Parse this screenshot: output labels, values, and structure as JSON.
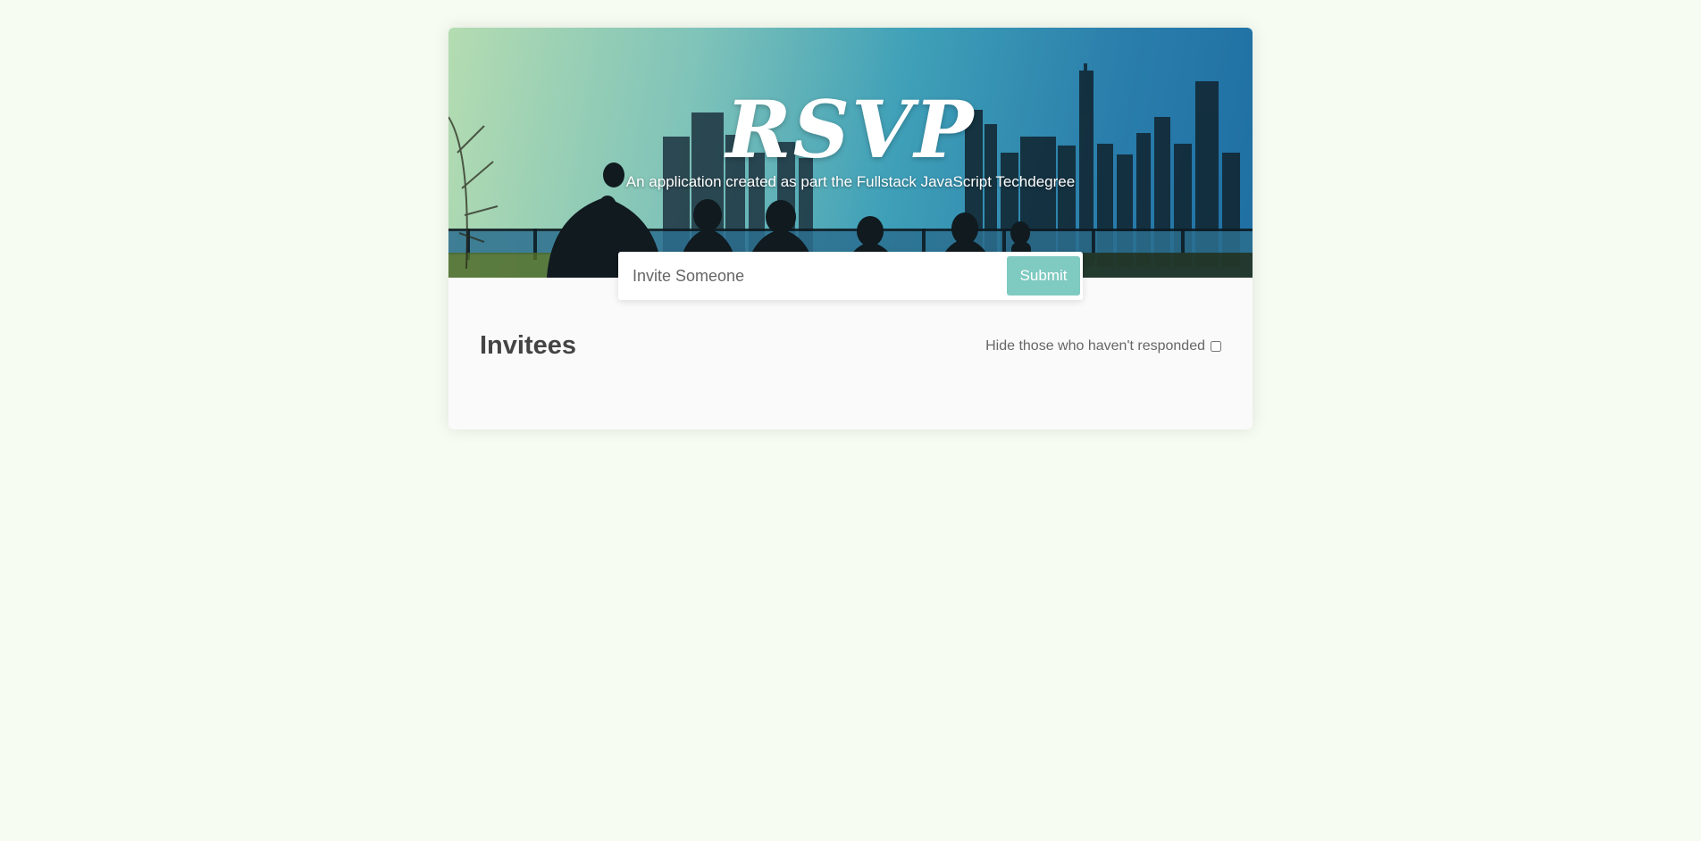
{
  "header": {
    "title": "RSVP",
    "subtitle": "An application created as part the Fullstack JavaScript Techdegree"
  },
  "invite_form": {
    "placeholder": "Invite Someone",
    "value": "",
    "submit_label": "Submit"
  },
  "main": {
    "heading": "Invitees",
    "filter_label": "Hide those who haven't responded",
    "filter_checked": false
  },
  "colors": {
    "page_background": "#f6fcf2",
    "card_background": "#fafafa",
    "submit_button": "#7fcac1",
    "heading_text": "#444444"
  }
}
